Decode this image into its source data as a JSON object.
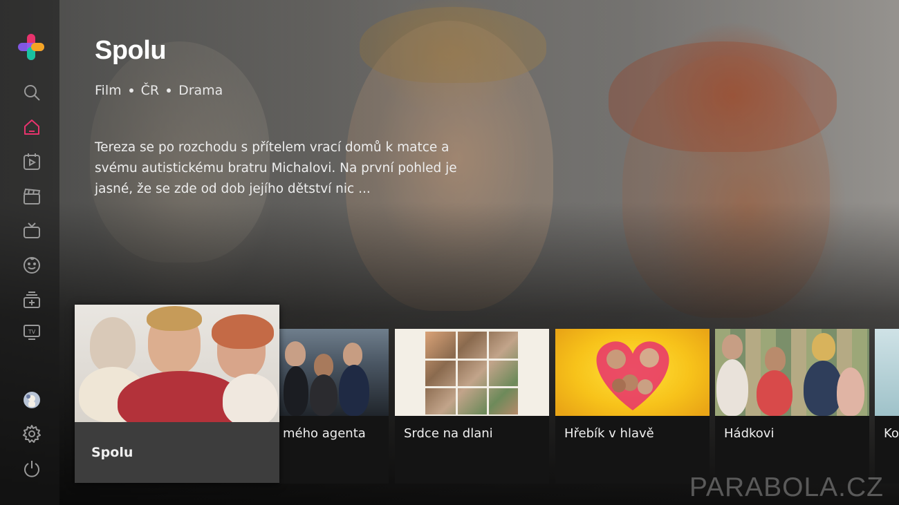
{
  "sidebar": {
    "logo_icon": "plus-logo-icon",
    "accent_color": "#e8336d",
    "items": [
      {
        "icon": "search-icon",
        "active": false
      },
      {
        "icon": "home-icon",
        "active": true
      },
      {
        "icon": "play-calendar-icon",
        "active": false
      },
      {
        "icon": "clapperboard-icon",
        "active": false
      },
      {
        "icon": "tv-icon",
        "active": false
      },
      {
        "icon": "kids-face-icon",
        "active": false
      },
      {
        "icon": "stack-add-icon",
        "active": false
      },
      {
        "icon": "live-tv-icon",
        "active": false
      }
    ],
    "bottom_items": [
      {
        "icon": "profile-avatar-icon"
      },
      {
        "icon": "gear-icon"
      },
      {
        "icon": "power-icon"
      }
    ]
  },
  "hero": {
    "title": "Spolu",
    "meta": [
      "Film",
      "ČR",
      "Drama"
    ],
    "description": "Tereza se po rozchodu s přítelem vrací domů k matce a svému autistickému bratru Michalovi. Na první pohled je jasné, že se zde od dob jejího dětství nic ..."
  },
  "carousel": {
    "focused": {
      "title": "Spolu"
    },
    "items": [
      {
        "title": "mého agenta"
      },
      {
        "title": "Srdce na dlani"
      },
      {
        "title": "Hřebík v hlavě"
      },
      {
        "title": "Hádkovi"
      },
      {
        "title": "Ko"
      }
    ]
  },
  "watermark": "PARABOLA.CZ"
}
